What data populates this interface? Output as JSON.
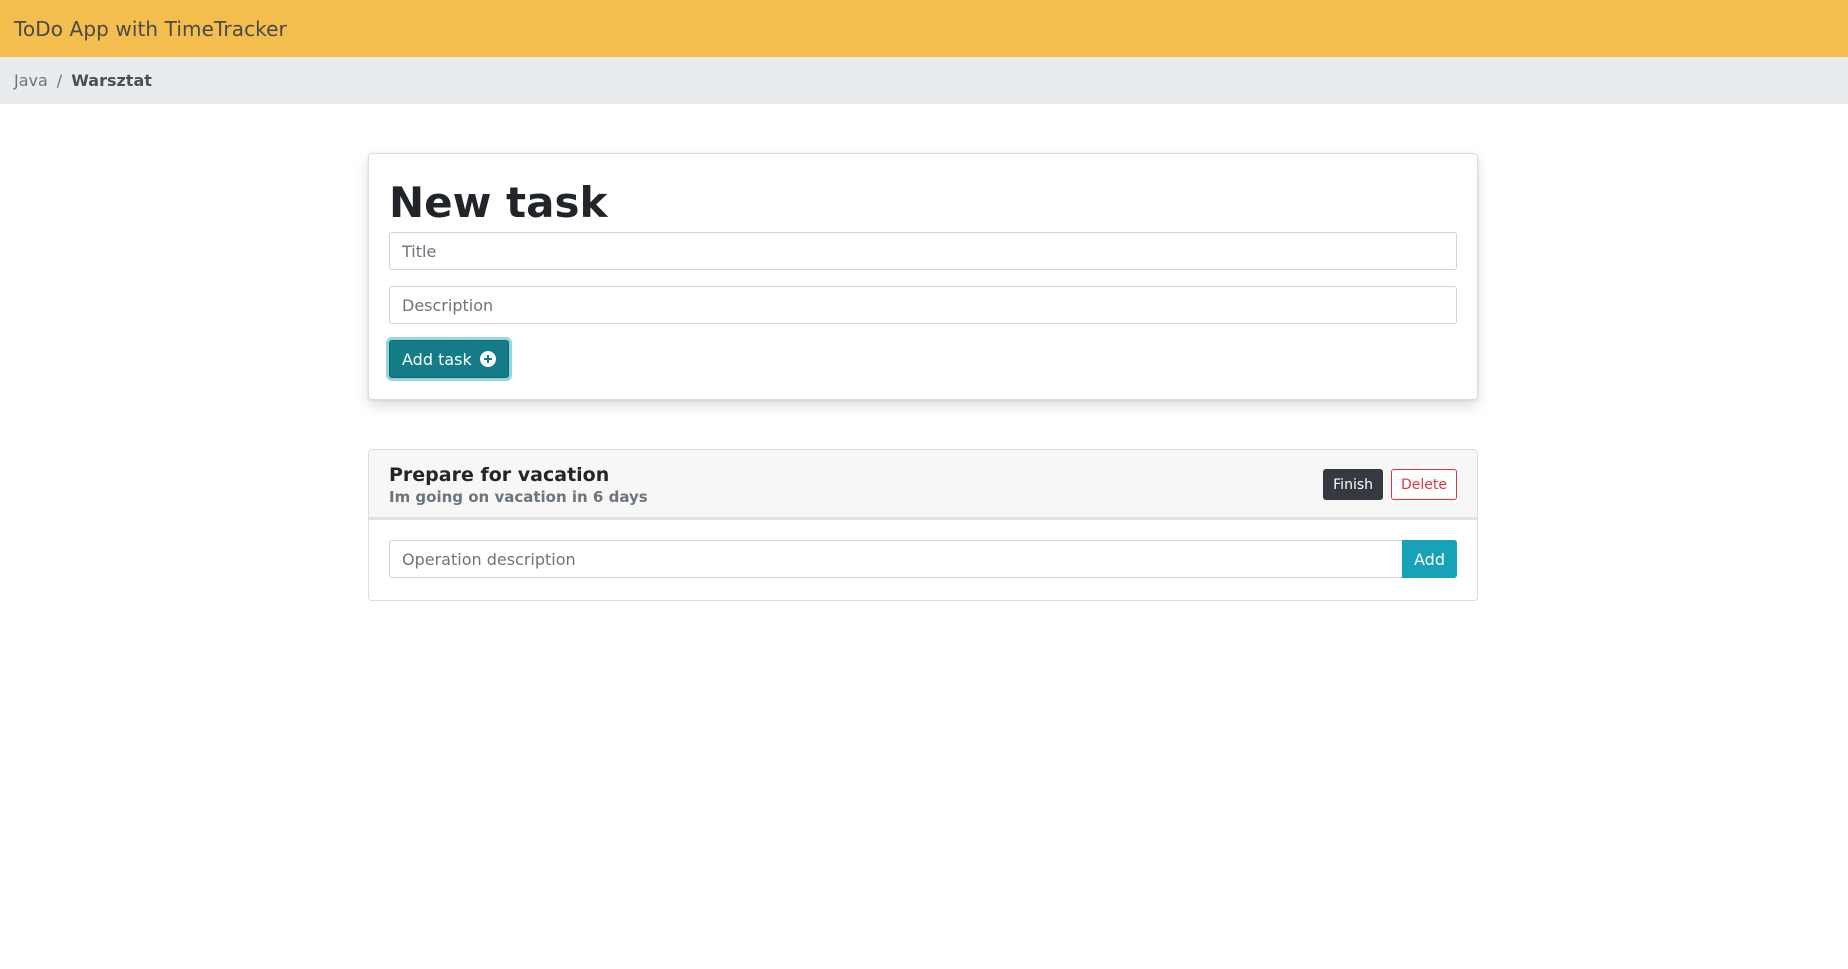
{
  "navbar": {
    "brand": "ToDo App with TimeTracker"
  },
  "breadcrumb": {
    "items": [
      {
        "label": "Java"
      },
      {
        "label": "Warsztat"
      }
    ],
    "separator": "/"
  },
  "new_task": {
    "heading": "New task",
    "title_placeholder": "Title",
    "title_value": "",
    "description_placeholder": "Description",
    "description_value": "",
    "add_button_label": "Add task",
    "add_button_icon": "plus-circle-icon"
  },
  "tasks": [
    {
      "title": "Prepare for vacation",
      "description": "Im going on vacation in 6 days",
      "finish_label": "Finish",
      "delete_label": "Delete",
      "operation_placeholder": "Operation description",
      "operation_value": "",
      "add_operation_label": "Add"
    }
  ],
  "colors": {
    "navbar": "#f3be4e",
    "breadcrumb_bg": "#e9ecef",
    "primary_teal": "#137c87",
    "info": "#17a2b8",
    "dark": "#343a40",
    "danger": "#dc3545"
  }
}
